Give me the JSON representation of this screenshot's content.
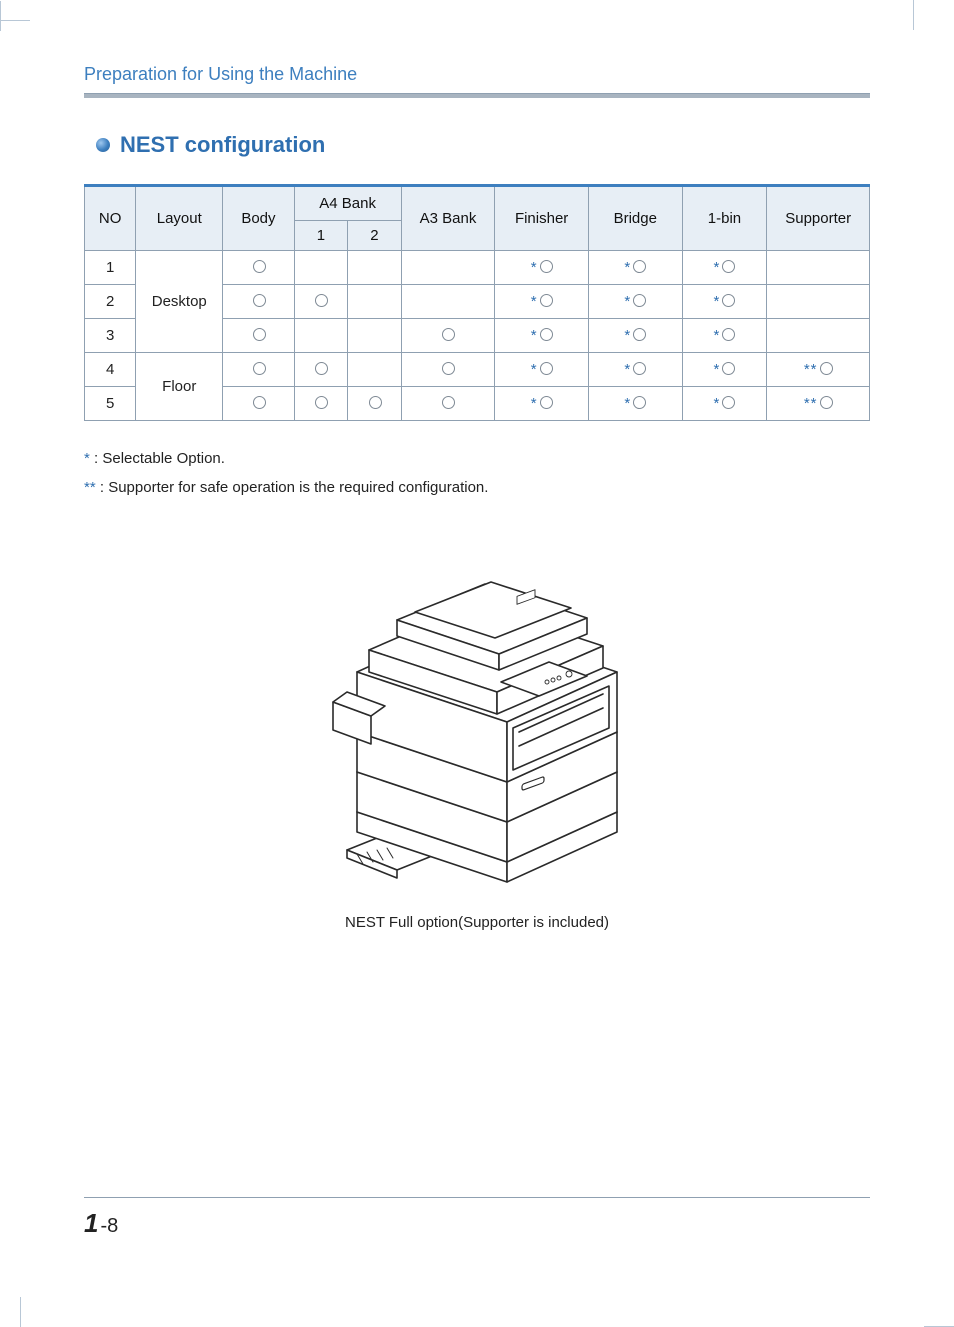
{
  "header": {
    "title": "Preparation for Using the Machine"
  },
  "section": {
    "title": "NEST configuration"
  },
  "table": {
    "head": {
      "no": "NO",
      "layout": "Layout",
      "body": "Body",
      "a4bank": "A4 Bank",
      "a4_1": "1",
      "a4_2": "2",
      "a3bank": "A3 Bank",
      "finisher": "Finisher",
      "bridge": "Bridge",
      "onebin": "1-bin",
      "supporter": "Supporter"
    },
    "layouts": {
      "desktop": "Desktop",
      "floor": "Floor"
    },
    "rows": [
      {
        "no": "1",
        "body": "o",
        "a4_1": "",
        "a4_2": "",
        "a3": "",
        "fin": "*o",
        "br": "*o",
        "bin": "*o",
        "sup": ""
      },
      {
        "no": "2",
        "body": "o",
        "a4_1": "o",
        "a4_2": "",
        "a3": "",
        "fin": "*o",
        "br": "*o",
        "bin": "*o",
        "sup": ""
      },
      {
        "no": "3",
        "body": "o",
        "a4_1": "",
        "a4_2": "",
        "a3": "o",
        "fin": "*o",
        "br": "*o",
        "bin": "*o",
        "sup": ""
      },
      {
        "no": "4",
        "body": "o",
        "a4_1": "o",
        "a4_2": "",
        "a3": "o",
        "fin": "*o",
        "br": "*o",
        "bin": "*o",
        "sup": "**o"
      },
      {
        "no": "5",
        "body": "o",
        "a4_1": "o",
        "a4_2": "o",
        "a3": "o",
        "fin": "*o",
        "br": "*o",
        "bin": "*o",
        "sup": "**o"
      }
    ]
  },
  "notes": {
    "n1_prefix": "* ",
    "n1_text": ": Selectable Option.",
    "n2_prefix": "**",
    "n2_text": ": Supporter for safe operation is the required configuration."
  },
  "figure": {
    "caption": "NEST Full option(Supporter is included)"
  },
  "footer": {
    "chapter": "1",
    "sep": "-",
    "page": "8"
  }
}
